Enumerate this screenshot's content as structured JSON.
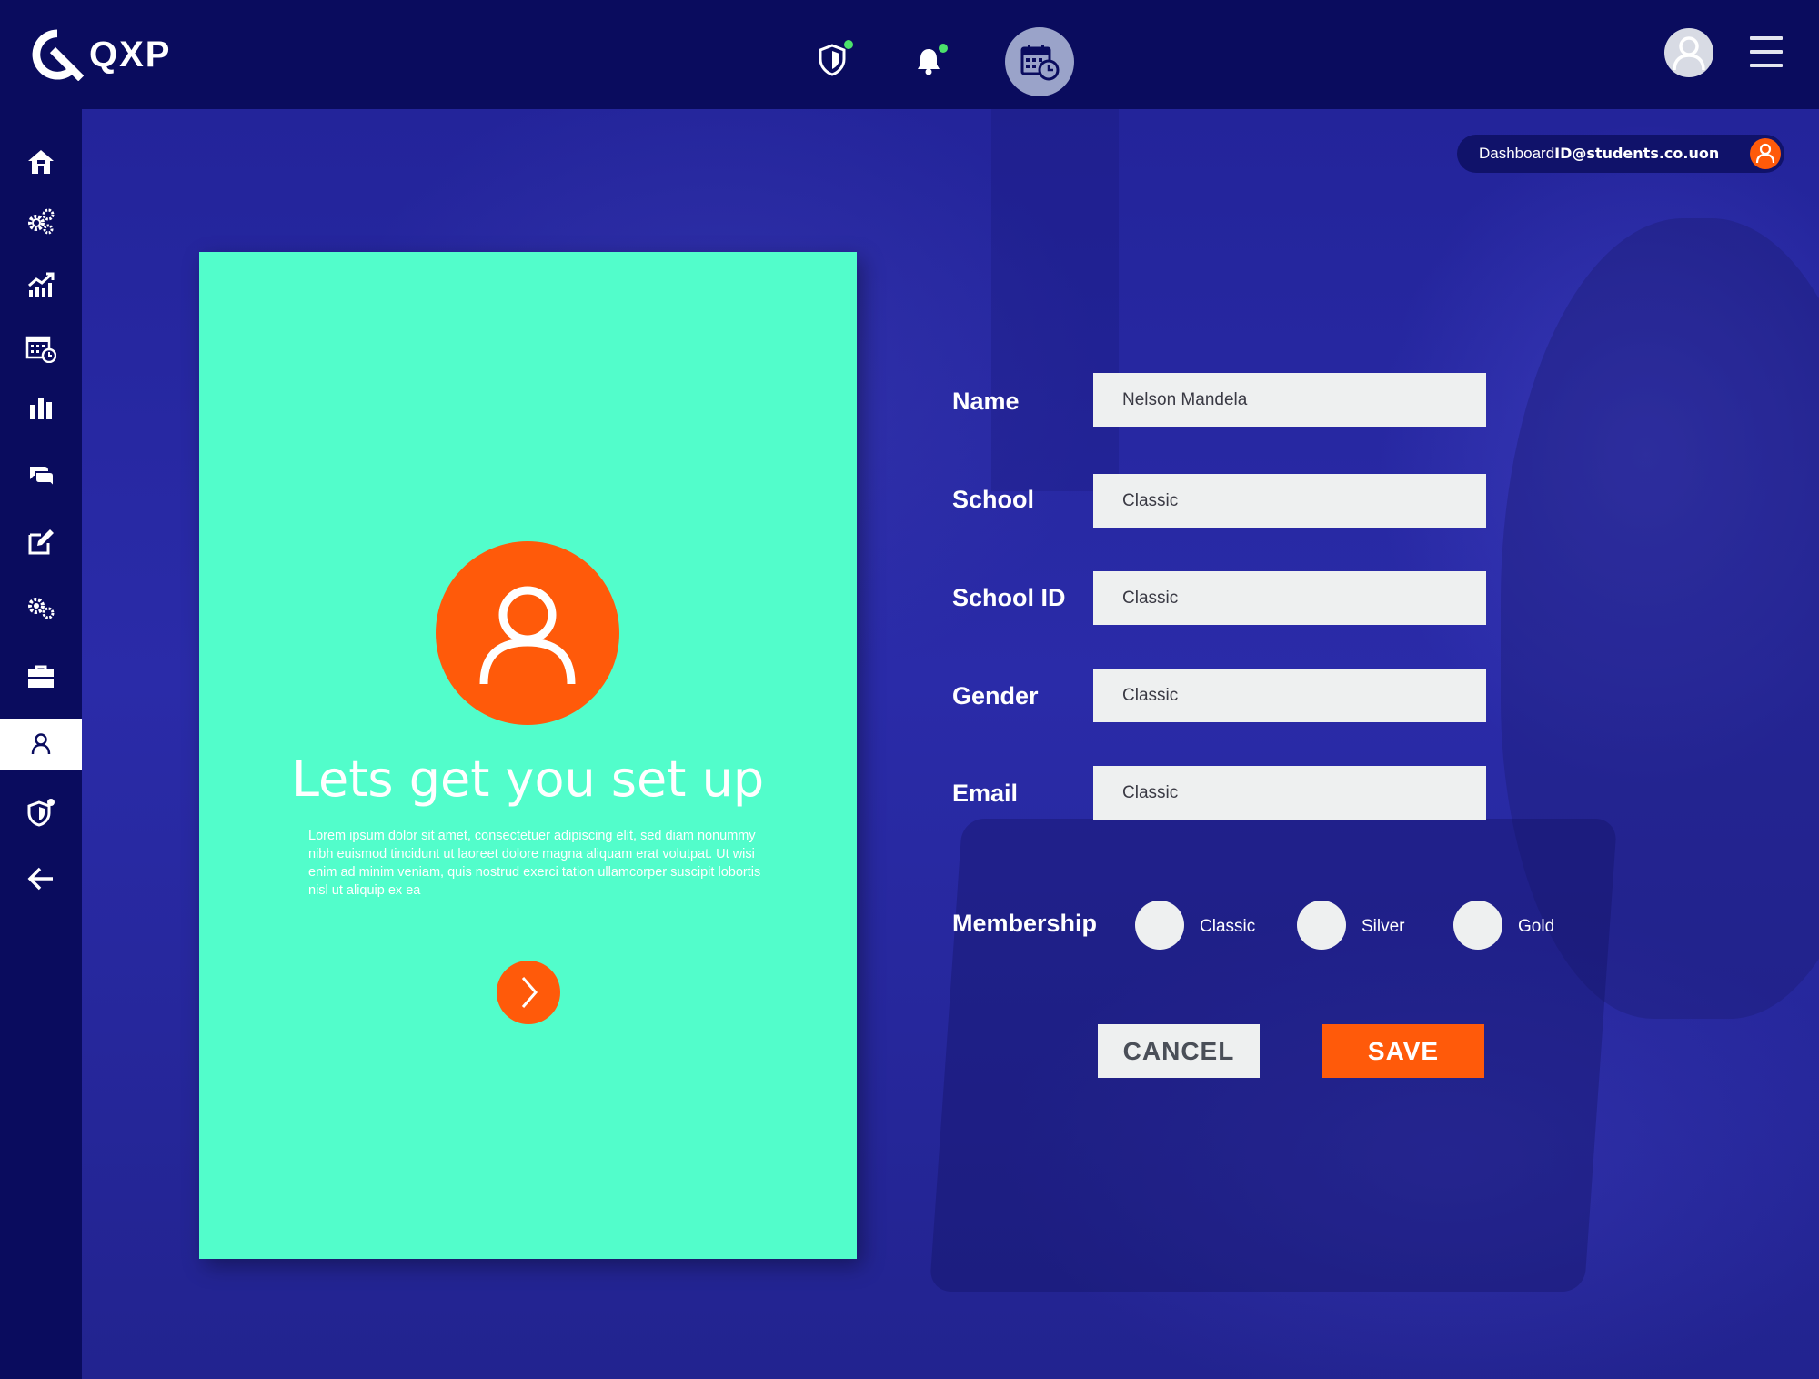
{
  "app": {
    "logo_text": "QXP"
  },
  "header": {
    "icons": [
      "shield-icon",
      "bell-icon",
      "calendar-clock-icon",
      "user-avatar",
      "hamburger-menu-icon"
    ],
    "notification_dot_color": "#4ce26b"
  },
  "sidebar": {
    "items": [
      {
        "icon": "home-icon"
      },
      {
        "icon": "gears-icon"
      },
      {
        "icon": "growth-chart-icon"
      },
      {
        "icon": "calendar-icon"
      },
      {
        "icon": "bar-chart-icon"
      },
      {
        "icon": "chat-icon"
      },
      {
        "icon": "edit-icon"
      },
      {
        "icon": "settings-icon"
      },
      {
        "icon": "briefcase-icon"
      },
      {
        "icon": "user-icon",
        "active": true
      },
      {
        "icon": "security-icon"
      },
      {
        "icon": "back-arrow-icon"
      }
    ]
  },
  "account": {
    "prefix": "Dashboard",
    "email": "ID@students.co.uon"
  },
  "card": {
    "title": "Lets get you set up",
    "body": "Lorem ipsum dolor sit amet, consectetuer adipiscing elit, sed diam nonummy nibh euismod tincidunt ut laoreet dolore magna aliquam erat volutpat. Ut wisi enim ad minim veniam, quis nostrud exerci tation ullamcorper suscipit lobortis nisl ut aliquip ex ea",
    "background": "#52fdcb"
  },
  "form": {
    "fields": [
      {
        "label": "Name",
        "value": "Nelson Mandela"
      },
      {
        "label": "School",
        "value": "Classic"
      },
      {
        "label": "School ID",
        "value": "Classic"
      },
      {
        "label": "Gender",
        "value": "Classic"
      },
      {
        "label": "Email",
        "value": "Classic"
      }
    ],
    "membership": {
      "label": "Membership",
      "options": [
        "Classic",
        "Silver",
        "Gold"
      ]
    },
    "cancel_label": "CANCEL",
    "save_label": "SAVE"
  },
  "colors": {
    "accent": "#ff5a0a",
    "nav_bg": "#0a0c5e",
    "main_bg": "#2a2ba8"
  }
}
